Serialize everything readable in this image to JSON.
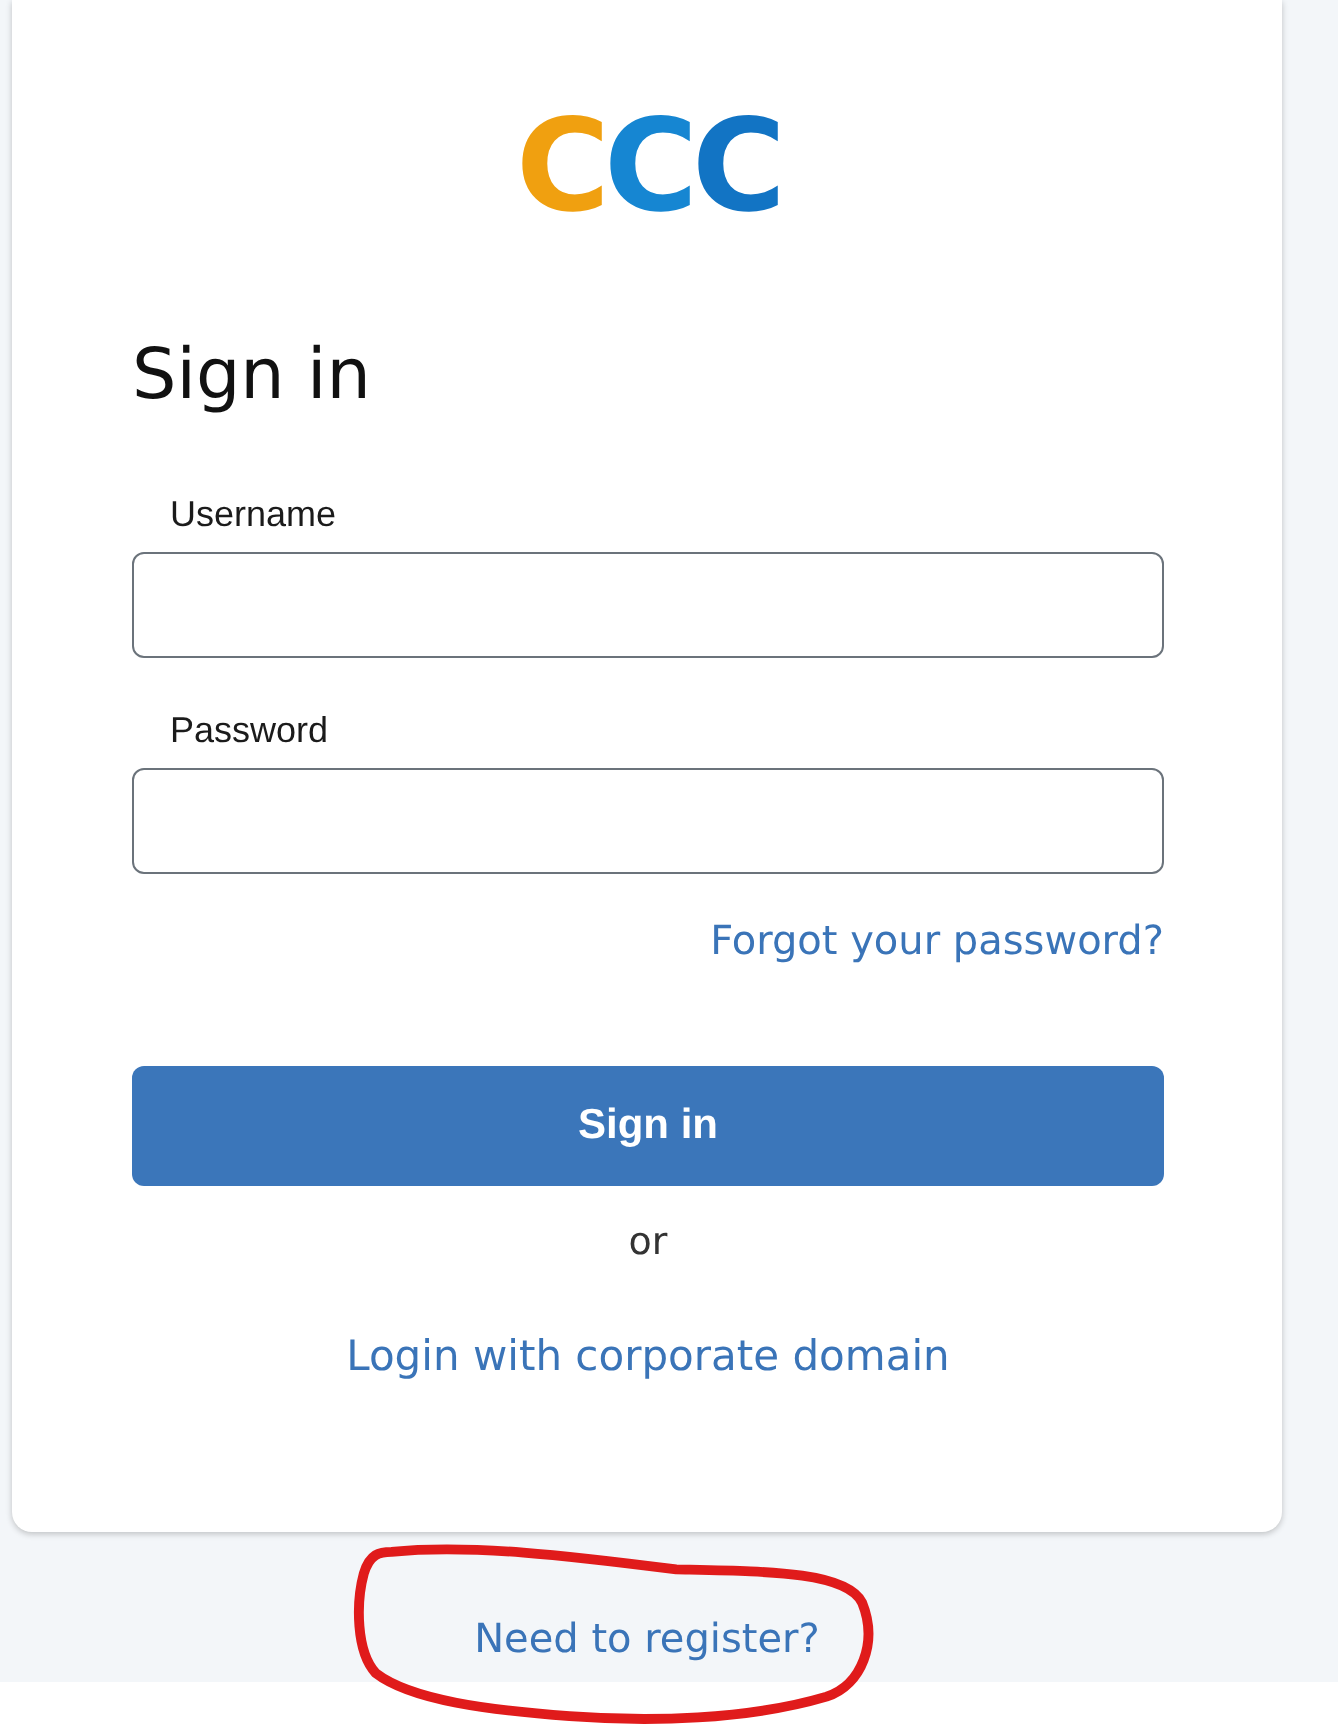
{
  "logo": {
    "letters": [
      {
        "char": "C",
        "color": "#f0a010"
      },
      {
        "char": "C",
        "color": "#1686d2"
      },
      {
        "char": "C",
        "color": "#1274c4"
      }
    ]
  },
  "heading": "Sign in",
  "fields": [
    {
      "label": "Username"
    },
    {
      "label": "Password"
    }
  ],
  "forgot_link": "Forgot your password?",
  "submit_button": "Sign in",
  "separator": "or",
  "corporate_link": "Login with corporate domain",
  "register_link": {
    "label": "Need to register?",
    "circled": true
  }
}
